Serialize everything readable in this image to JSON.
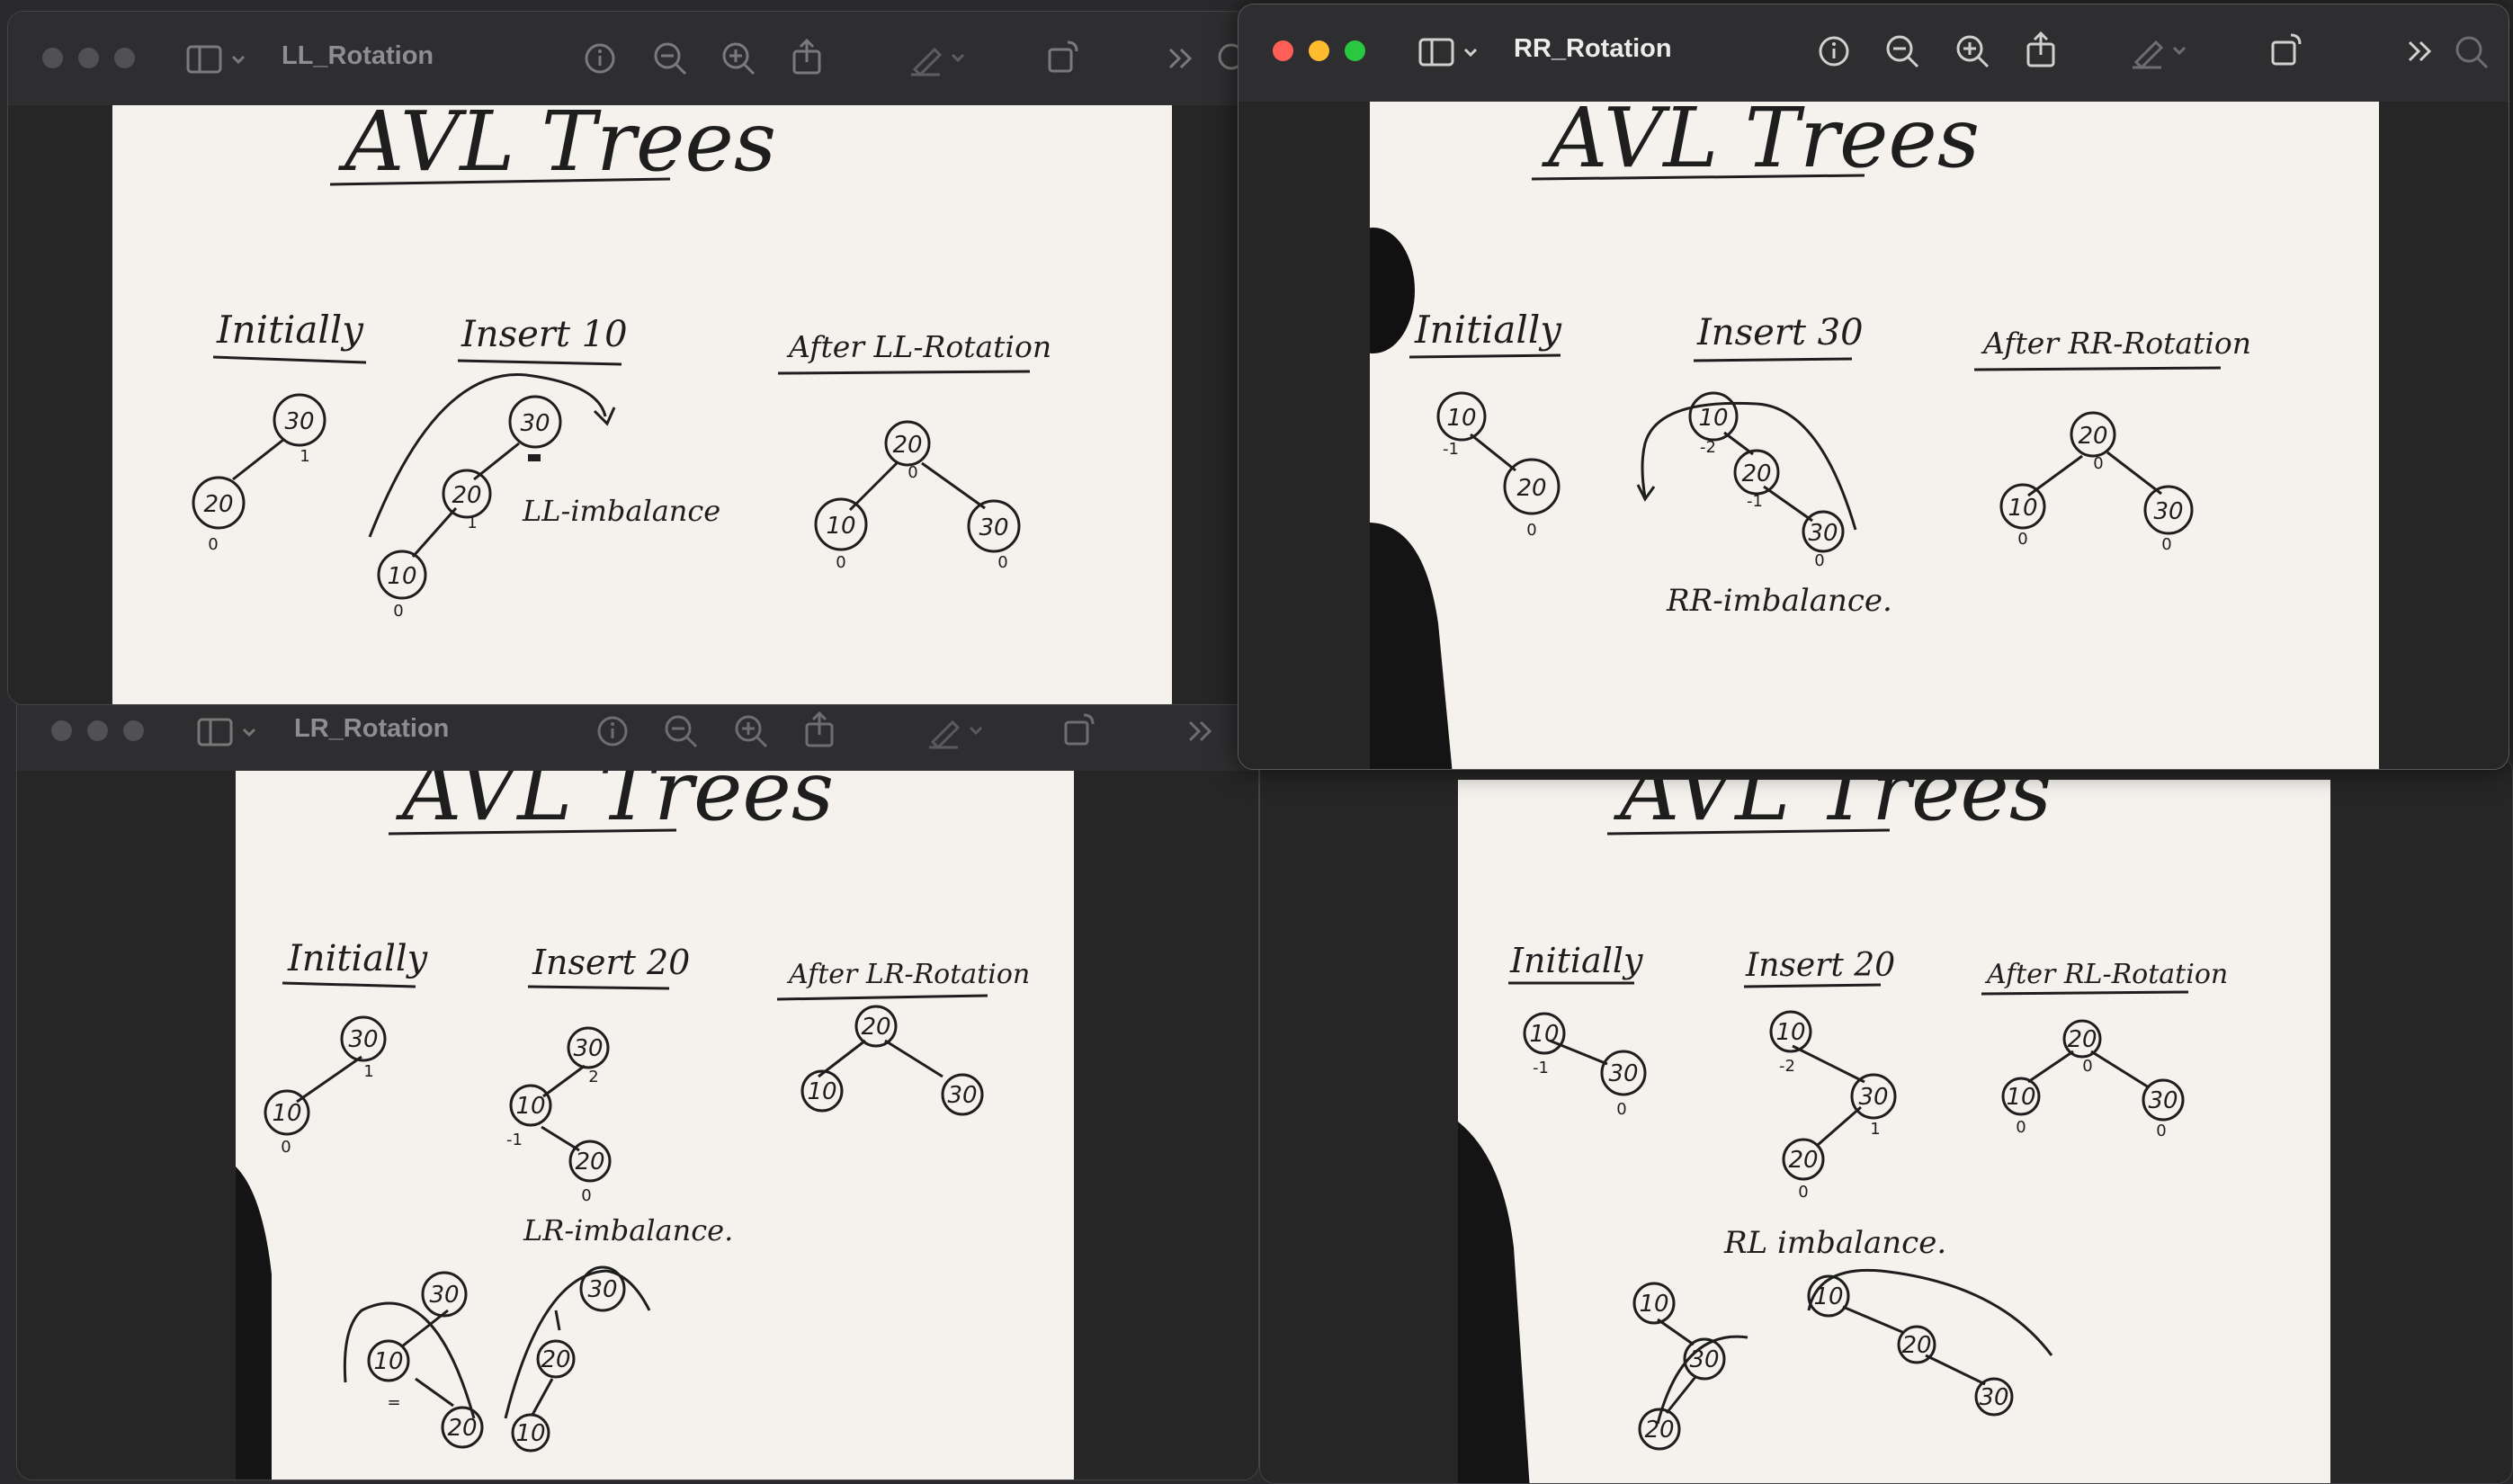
{
  "windows": {
    "ll": {
      "title": "LL_Rotation",
      "board": {
        "heading": "AVL Trees",
        "col1": "Initially",
        "col2": "Insert 10",
        "col3": "After LL-Rotation",
        "note": "LL-imbalance",
        "nodes": [
          "30",
          "20",
          "30",
          "20",
          "10",
          "20",
          "10",
          "30"
        ],
        "balance": [
          "1",
          "0",
          "0",
          "1",
          "0",
          "0",
          "0",
          "0"
        ]
      }
    },
    "rr": {
      "title": "RR_Rotation",
      "board": {
        "heading": "AVL Trees",
        "col1": "Initially",
        "col2": "Insert 30",
        "col3": "After RR-Rotation",
        "note": "RR-imbalance.",
        "nodes": [
          "10",
          "20",
          "10",
          "20",
          "30",
          "20",
          "10",
          "30"
        ],
        "balance": [
          "-1",
          "0",
          "-2",
          "-1",
          "0",
          "0",
          "0",
          "0"
        ]
      }
    },
    "lr": {
      "title": "LR_Rotation",
      "board": {
        "heading": "AVL Trees",
        "col1": "Initially",
        "col2": "Insert 20",
        "col3": "After LR-Rotation",
        "note": "LR-imbalance.",
        "nodes": [
          "30",
          "10",
          "30",
          "10",
          "20",
          "20",
          "10",
          "30",
          "30",
          "10",
          "20",
          "30",
          "20",
          "10"
        ],
        "balance": [
          "1",
          "0",
          "2",
          "-1",
          "0",
          "="
        ]
      }
    },
    "rl": {
      "title": "",
      "board": {
        "heading": "AVL Trees",
        "col1": "Initially",
        "col2": "Insert 20",
        "col3": "After RL-Rotation",
        "note": "RL imbalance.",
        "nodes": [
          "10",
          "30",
          "10",
          "30",
          "20",
          "20",
          "10",
          "30",
          "10",
          "30",
          "20",
          "10",
          "20",
          "30"
        ],
        "balance": [
          "-1",
          "0",
          "-2",
          "1",
          "0",
          "0",
          "0",
          "0"
        ]
      }
    }
  },
  "toolbar": {
    "icons": [
      "sidebar-icon",
      "chevron-down-icon",
      "info-icon",
      "zoom-out-icon",
      "zoom-in-icon",
      "share-icon",
      "markup-icon",
      "chevron-down-icon",
      "rotate-icon",
      "overflow-chevrons-icon",
      "search-icon"
    ]
  },
  "colors": {
    "close": "#ff5f57",
    "minimize": "#febc2e",
    "zoom": "#28c840",
    "whiteboard": "#f5f2ee"
  }
}
